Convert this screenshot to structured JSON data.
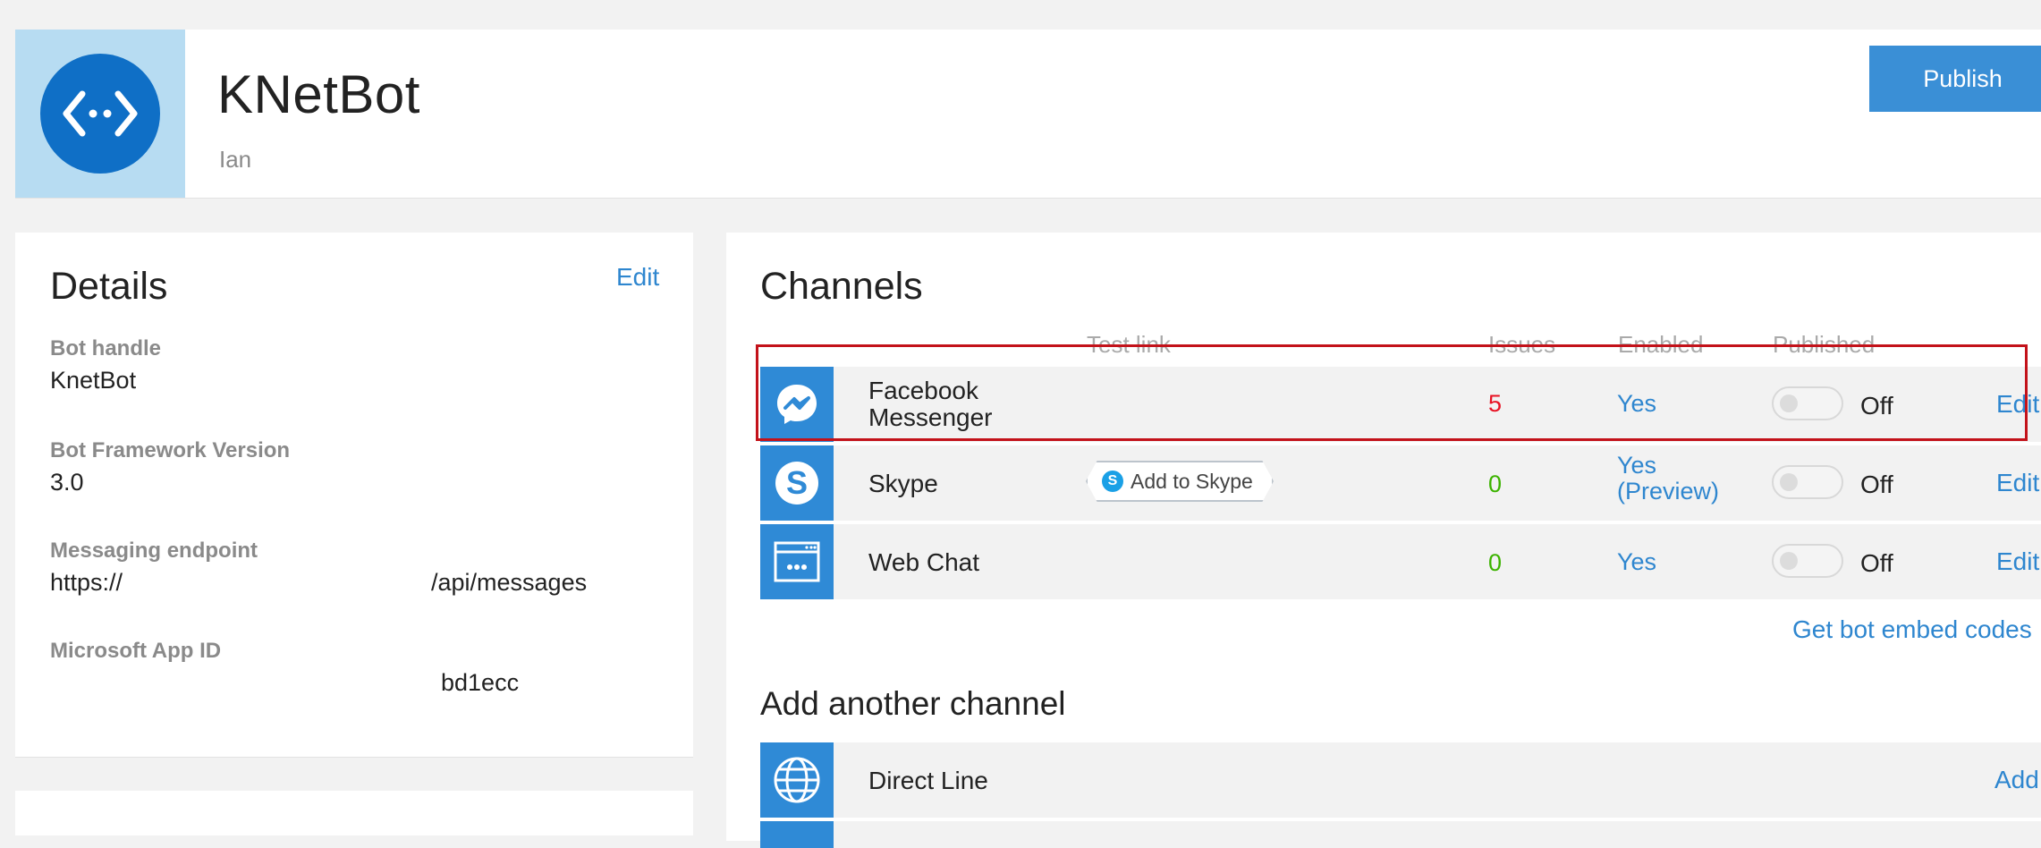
{
  "header": {
    "title": "KNetBot",
    "owner": "Ian",
    "publish_label": "Publish"
  },
  "details": {
    "title": "Details",
    "edit_label": "Edit",
    "fields": [
      {
        "label": "Bot handle",
        "value": "KnetBot"
      },
      {
        "label": "Bot Framework Version",
        "value": "3.0"
      },
      {
        "label": "Messaging endpoint",
        "value_start": "https://",
        "value_end": "/api/messages"
      },
      {
        "label": "Microsoft App ID",
        "value": "bd1ecc"
      }
    ]
  },
  "channels": {
    "title": "Channels",
    "columns": {
      "test_link": "Test link",
      "issues": "Issues",
      "enabled": "Enabled",
      "published": "Published"
    },
    "rows": [
      {
        "name_line1": "Facebook",
        "name_line2": "Messenger",
        "issues": "5",
        "issues_color": "#e81123",
        "enabled_line1": "Yes",
        "enabled_line2": "",
        "published": "Off",
        "edit": "Edit",
        "icon": "messenger-icon"
      },
      {
        "name_line1": "Skype",
        "name_line2": "",
        "test_link": "Add to Skype",
        "issues": "0",
        "issues_color": "#3cb300",
        "enabled_line1": "Yes",
        "enabled_line2": "(Preview)",
        "published": "Off",
        "edit": "Edit",
        "icon": "skype-icon"
      },
      {
        "name_line1": "Web Chat",
        "name_line2": "",
        "issues": "0",
        "issues_color": "#3cb300",
        "enabled_line1": "Yes",
        "enabled_line2": "",
        "published": "Off",
        "edit": "Edit",
        "icon": "web-chat-icon"
      }
    ],
    "embed_codes_label": "Get bot embed codes",
    "add_title": "Add another channel",
    "add_rows": [
      {
        "name": "Direct Line",
        "action": "Add",
        "icon": "globe-icon"
      }
    ]
  },
  "colors": {
    "accent": "#2e86cf",
    "publish_bg": "#3a8fd6",
    "logo_bg": "#b7dcf2",
    "logo_circle": "#0f6fc6",
    "highlight": "#c3121a"
  }
}
